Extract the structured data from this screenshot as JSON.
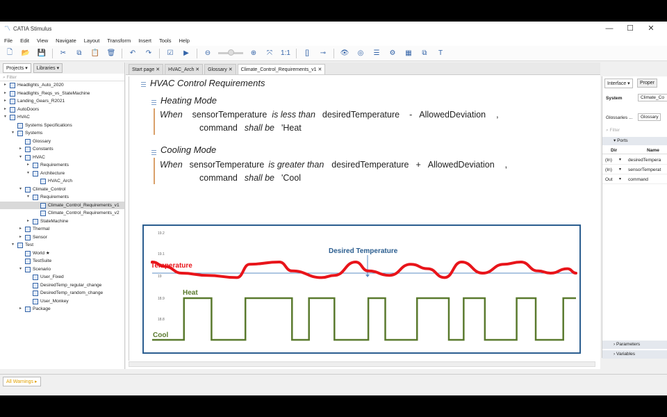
{
  "window": {
    "title": "CATIA Stimulus",
    "controls": [
      "—",
      "☐",
      "✕"
    ]
  },
  "menu": [
    "File",
    "Edit",
    "View",
    "Navigate",
    "Layout",
    "Transform",
    "Insert",
    "Tools",
    "Help"
  ],
  "toolbar": {
    "icons": [
      "new-file-icon",
      "open-icon",
      "save-icon",
      "cut-icon",
      "copy-icon",
      "paste-icon",
      "delete-icon",
      "undo-icon",
      "redo-icon",
      "check-icon",
      "run-icon",
      "zoom-out-icon",
      "zoom-in-icon",
      "fit-icon",
      "one-to-one-icon",
      "layout-icon",
      "link-icon",
      "eye-icon",
      "target-icon",
      "list-icon",
      "settings-icon",
      "table-icon",
      "window-icon",
      "text-icon"
    ],
    "glyphs": [
      "🗋",
      "📂",
      "💾",
      "✂",
      "⧉",
      "📋",
      "🗑",
      "↶",
      "↷",
      "☑",
      "▶",
      "⊖",
      "⊕",
      "⤧",
      "1:1",
      "[]",
      "⊸",
      "👁",
      "◎",
      "☰",
      "⚙",
      "▦",
      "⧉",
      "T"
    ]
  },
  "left_panel": {
    "tabs": [
      "Projects",
      "Libraries"
    ],
    "filter_placeholder": "Filter",
    "tree": [
      {
        "label": "Headlights_Auto_2020",
        "level": 0,
        "arrow": "▸",
        "icon": "project"
      },
      {
        "label": "Headlights_Reqs_vs_StateMachine",
        "level": 0,
        "arrow": "▸",
        "icon": "project"
      },
      {
        "label": "Landing_Gears_R2021",
        "level": 0,
        "arrow": "▸",
        "icon": "project"
      },
      {
        "label": "AutoDoors",
        "level": 0,
        "arrow": "▸",
        "icon": "project"
      },
      {
        "label": "HVAC",
        "level": 0,
        "arrow": "▾",
        "icon": "project"
      },
      {
        "label": "Systems Specifications",
        "level": 1,
        "arrow": "",
        "icon": "spec"
      },
      {
        "label": "Systems",
        "level": 1,
        "arrow": "▾",
        "icon": "package"
      },
      {
        "label": "Glossary",
        "level": 2,
        "arrow": "",
        "icon": "glossary"
      },
      {
        "label": "Constants",
        "level": 2,
        "arrow": "▸",
        "icon": "package"
      },
      {
        "label": "HVAC",
        "level": 2,
        "arrow": "▾",
        "icon": "package"
      },
      {
        "label": "Requirements",
        "level": 3,
        "arrow": "▸",
        "icon": "package"
      },
      {
        "label": "Architecture",
        "level": 3,
        "arrow": "▾",
        "icon": "package"
      },
      {
        "label": "HVAC_Arch",
        "level": 4,
        "arrow": "",
        "icon": "doc"
      },
      {
        "label": "Climate_Control",
        "level": 2,
        "arrow": "▾",
        "icon": "package"
      },
      {
        "label": "Requirements",
        "level": 3,
        "arrow": "▾",
        "icon": "package"
      },
      {
        "label": "Climate_Control_Requirements_v1",
        "level": 4,
        "arrow": "",
        "icon": "doc",
        "selected": true
      },
      {
        "label": "Climate_Control_Requirements_v2",
        "level": 4,
        "arrow": "",
        "icon": "doc"
      },
      {
        "label": "StateMachine",
        "level": 3,
        "arrow": "▸",
        "icon": "package"
      },
      {
        "label": "Thermal",
        "level": 2,
        "arrow": "▸",
        "icon": "package"
      },
      {
        "label": "Sensor",
        "level": 2,
        "arrow": "▸",
        "icon": "package"
      },
      {
        "label": "Test",
        "level": 1,
        "arrow": "▾",
        "icon": "package"
      },
      {
        "label": "World ★",
        "level": 2,
        "arrow": "",
        "icon": "doc"
      },
      {
        "label": "TestSuite",
        "level": 2,
        "arrow": "",
        "icon": "doc"
      },
      {
        "label": "Scenario",
        "level": 2,
        "arrow": "▾",
        "icon": "package"
      },
      {
        "label": "User_Fixed",
        "level": 3,
        "arrow": "",
        "icon": "doc"
      },
      {
        "label": "DesiredTemp_regular_change",
        "level": 3,
        "arrow": "",
        "icon": "doc"
      },
      {
        "label": "DesiredTemp_random_change",
        "level": 3,
        "arrow": "",
        "icon": "doc"
      },
      {
        "label": "User_Monkey",
        "level": 3,
        "arrow": "",
        "icon": "doc"
      },
      {
        "label": "Package",
        "level": 2,
        "arrow": "▸",
        "icon": "package"
      }
    ]
  },
  "editor": {
    "tabs": [
      {
        "label": "Start page ✕",
        "active": false
      },
      {
        "label": "HVAC_Arch ✕",
        "active": false
      },
      {
        "label": "Glossary ✕",
        "active": false
      },
      {
        "label": "Climate_Control_Requirements_v1 ✕",
        "active": true
      }
    ],
    "title": "HVAC Control Requirements",
    "sections": [
      {
        "heading": "Heating Mode",
        "line1": [
          "When",
          "sensorTemperature",
          "is less than",
          "desiredTemperature",
          "-",
          "AllowedDeviation",
          ","
        ],
        "line2": [
          "command",
          "shall be",
          "'Heat"
        ]
      },
      {
        "heading": "Cooling Mode",
        "line1": [
          "When",
          "sensorTemperature",
          "is greater than",
          "desiredTemperature",
          "+",
          "AllowedDeviation",
          ","
        ],
        "line2": [
          "command",
          "shall be",
          "'Cool"
        ]
      }
    ]
  },
  "chart_data": {
    "type": "line",
    "y_ticks": [
      "19.2",
      "19.1",
      "19",
      "18.9",
      "18.8"
    ],
    "labels": {
      "desired": "Desired Temperature",
      "temperature": "Temperature",
      "heat": "Heat",
      "cool": "Cool"
    },
    "colors": {
      "temperature": "#e8141a",
      "command": "#5a7a2e",
      "desired_line": "#5b8cc4",
      "desired_label": "#2a5d8f",
      "frame": "#2a5d8f"
    },
    "desired_value": 19.0,
    "temperature_points": [
      [
        0,
        19.05
      ],
      [
        0.03,
        19.03
      ],
      [
        0.07,
        19.0
      ],
      [
        0.13,
        18.99
      ],
      [
        0.2,
        18.98
      ],
      [
        0.23,
        19.04
      ],
      [
        0.3,
        19.05
      ],
      [
        0.33,
        19.01
      ],
      [
        0.4,
        18.98
      ],
      [
        0.43,
        18.99
      ],
      [
        0.48,
        19.05
      ],
      [
        0.51,
        19.01
      ],
      [
        0.56,
        18.99
      ],
      [
        0.61,
        19.04
      ],
      [
        0.65,
        19.02
      ],
      [
        0.69,
        18.98
      ],
      [
        0.73,
        19.05
      ],
      [
        0.78,
        19.0
      ],
      [
        0.83,
        19.04
      ],
      [
        0.87,
        19.05
      ],
      [
        0.91,
        19.01
      ],
      [
        0.94,
        19.0
      ],
      [
        0.98,
        19.02
      ],
      [
        1.0,
        19.0
      ]
    ],
    "command_points": [
      [
        0,
        0
      ],
      [
        0.075,
        0
      ],
      [
        0.075,
        1
      ],
      [
        0.14,
        1
      ],
      [
        0.14,
        0
      ],
      [
        0.22,
        0
      ],
      [
        0.22,
        1
      ],
      [
        0.33,
        1
      ],
      [
        0.33,
        0
      ],
      [
        0.37,
        0
      ],
      [
        0.37,
        1
      ],
      [
        0.43,
        1
      ],
      [
        0.43,
        0
      ],
      [
        0.51,
        0
      ],
      [
        0.51,
        1
      ],
      [
        0.55,
        1
      ],
      [
        0.55,
        0
      ],
      [
        0.625,
        0
      ],
      [
        0.625,
        1
      ],
      [
        0.7,
        1
      ],
      [
        0.7,
        0
      ],
      [
        0.735,
        0
      ],
      [
        0.735,
        1
      ],
      [
        0.785,
        1
      ],
      [
        0.785,
        0
      ],
      [
        0.86,
        0
      ],
      [
        0.86,
        1
      ],
      [
        0.905,
        1
      ],
      [
        0.905,
        0
      ],
      [
        0.97,
        0
      ],
      [
        0.97,
        1
      ],
      [
        1.0,
        1
      ]
    ]
  },
  "right_panel": {
    "tabs": [
      "Interface ▾",
      "Proper"
    ],
    "system_label": "System",
    "system_value": "Climate_Co",
    "glossaries_label": "Glossaries ...",
    "glossaries_value": "Glossary",
    "filter_placeholder": "Filter",
    "ports_label": "Ports",
    "columns": [
      "Dir",
      "Name"
    ],
    "ports": [
      {
        "dir": "(In)",
        "name": "desiredTempera"
      },
      {
        "dir": "(In)",
        "name": "sensorTemperat"
      },
      {
        "dir": "Out",
        "name": "command"
      }
    ],
    "parameters_label": "Parameters",
    "variables_label": "Variables"
  },
  "bottom": {
    "warnings_tab": "All Warnings ▸"
  }
}
